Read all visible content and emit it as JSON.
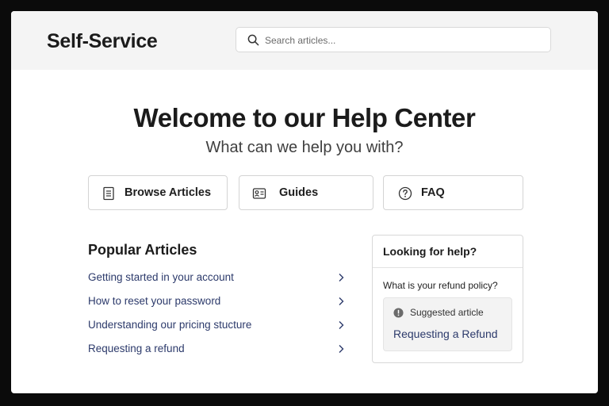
{
  "header": {
    "brand": "Self-Service",
    "search_placeholder": "Search articles..."
  },
  "hero": {
    "title": "Welcome to our Help Center",
    "subtitle": "What can we help you with?"
  },
  "quick_links": [
    {
      "label": "Browse Articles",
      "icon": "document-icon"
    },
    {
      "label": "Guides",
      "icon": "guide-icon"
    },
    {
      "label": "FAQ",
      "icon": "question-circle-icon"
    }
  ],
  "popular": {
    "title": "Popular Articles",
    "items": [
      {
        "label": "Getting started in your account"
      },
      {
        "label": "How to reset your password"
      },
      {
        "label": "Understanding our pricing stucture"
      },
      {
        "label": "Requesting a refund"
      }
    ]
  },
  "help_card": {
    "title": "Looking for help?",
    "question": "What is your refund policy?",
    "suggested_label": "Suggested article",
    "suggested_link": "Requesting a Refund"
  },
  "colors": {
    "link": "#2c3a6b",
    "header_bg": "#f4f4f4",
    "border": "#d4d4d4"
  }
}
